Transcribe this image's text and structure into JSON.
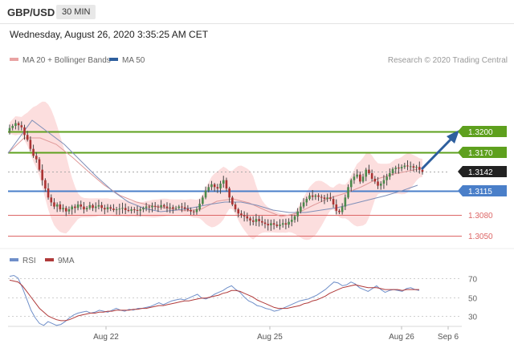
{
  "header": {
    "symbol": "GBP/USD",
    "timeframe": "30 MIN",
    "datetime": "Wednesday, August 26, 2020 3:35:25 AM CET"
  },
  "legend": {
    "ma20": "MA 20 + Bollinger Bands",
    "ma50": "MA 50",
    "copyright": "Research © 2020 Trading Central",
    "rsi": "RSI",
    "ma9": "9MA"
  },
  "colors": {
    "resistance": "#5ea01e",
    "support": "#4a7fc9",
    "weak_level": "#d66",
    "bollinger": "#fcdede",
    "ma20": "#e09a9a",
    "ma50": "#7f8fb8",
    "arrow": "#2e5f9e",
    "candle_up": "#4c8a4c",
    "candle_down": "#a33",
    "rsi": "#6f8fc9",
    "rsi_ma": "#b03a3a"
  },
  "chart_data": [
    {
      "type": "candlestick",
      "title": "",
      "price_range": [
        1.302,
        1.3255
      ],
      "x_ticks": [
        "Aug 22",
        "Aug 25",
        "Aug 26",
        "Sep 6"
      ],
      "levels": [
        {
          "value": 1.32,
          "label": "1.3200",
          "kind": "resistance"
        },
        {
          "value": 1.317,
          "label": "1.3170",
          "kind": "resistance"
        },
        {
          "value": 1.3142,
          "label": "1.3142",
          "kind": "current"
        },
        {
          "value": 1.3115,
          "label": "1.3115",
          "kind": "pivot"
        },
        {
          "value": 1.308,
          "label": "1.3080",
          "kind": "support"
        },
        {
          "value": 1.305,
          "label": "1.3050",
          "kind": "support"
        }
      ],
      "close": [
        1.3205,
        1.3208,
        1.3212,
        1.3209,
        1.3206,
        1.3195,
        1.3188,
        1.3175,
        1.3165,
        1.316,
        1.3145,
        1.313,
        1.3118,
        1.3105,
        1.3098,
        1.3092,
        1.3095,
        1.3088,
        1.309,
        1.3085,
        1.3088,
        1.3092,
        1.309,
        1.3095,
        1.3092,
        1.3088,
        1.309,
        1.3094,
        1.309,
        1.3092,
        1.3094,
        1.309,
        1.3088,
        1.3091,
        1.3089,
        1.3087,
        1.3088,
        1.3089,
        1.309,
        1.3087,
        1.3086,
        1.3088,
        1.3087,
        1.3086,
        1.3088,
        1.309,
        1.3092,
        1.3091,
        1.3093,
        1.3092,
        1.3091,
        1.3094,
        1.3092,
        1.309,
        1.3091,
        1.3089,
        1.309,
        1.3092,
        1.3091,
        1.3089,
        1.3087,
        1.3085,
        1.3084,
        1.3088,
        1.3096,
        1.3105,
        1.3115,
        1.312,
        1.3124,
        1.312,
        1.3118,
        1.3125,
        1.313,
        1.3118,
        1.3105,
        1.3095,
        1.3088,
        1.3082,
        1.308,
        1.3078,
        1.3075,
        1.3072,
        1.307,
        1.3074,
        1.3071,
        1.3069,
        1.3067,
        1.3065,
        1.3068,
        1.3066,
        1.3064,
        1.3066,
        1.3068,
        1.3066,
        1.307,
        1.3073,
        1.3078,
        1.3085,
        1.3092,
        1.3098,
        1.3103,
        1.3108,
        1.3106,
        1.3108,
        1.3106,
        1.3105,
        1.3103,
        1.3105,
        1.3103,
        1.3095,
        1.3086,
        1.3084,
        1.3092,
        1.3105,
        1.312,
        1.313,
        1.3135,
        1.3138,
        1.3128,
        1.3135,
        1.3145,
        1.314,
        1.3132,
        1.3128,
        1.3122,
        1.3125,
        1.313,
        1.3135,
        1.314,
        1.3146,
        1.3148,
        1.3147,
        1.3149,
        1.3151,
        1.315,
        1.315,
        1.3148,
        1.3149,
        1.3145,
        1.3142
      ],
      "ma20_points": [
        [
          10,
          191
        ],
        [
          30,
          172
        ],
        [
          50,
          172
        ],
        [
          70,
          180
        ],
        [
          90,
          196
        ],
        [
          110,
          214
        ],
        [
          130,
          231
        ],
        [
          150,
          244
        ],
        [
          170,
          252
        ],
        [
          190,
          257
        ],
        [
          210,
          260
        ],
        [
          230,
          263
        ],
        [
          250,
          261
        ],
        [
          270,
          251
        ],
        [
          290,
          248
        ],
        [
          310,
          253
        ],
        [
          330,
          262
        ],
        [
          350,
          270
        ],
        [
          370,
          266
        ],
        [
          390,
          256
        ],
        [
          410,
          247
        ],
        [
          430,
          241
        ],
        [
          450,
          233
        ],
        [
          470,
          223
        ],
        [
          490,
          217
        ],
        [
          510,
          213
        ],
        [
          520,
          211
        ]
      ],
      "ma50_points": [
        [
          10,
          191
        ],
        [
          40,
          150
        ],
        [
          60,
          165
        ],
        [
          80,
          180
        ],
        [
          100,
          200
        ],
        [
          120,
          220
        ],
        [
          140,
          238
        ],
        [
          160,
          252
        ],
        [
          180,
          260
        ],
        [
          200,
          264
        ],
        [
          220,
          262
        ],
        [
          240,
          259
        ],
        [
          260,
          255
        ],
        [
          280,
          252
        ],
        [
          300,
          252
        ],
        [
          320,
          256
        ],
        [
          340,
          262
        ],
        [
          360,
          265
        ],
        [
          380,
          265
        ],
        [
          400,
          262
        ],
        [
          420,
          259
        ],
        [
          440,
          254
        ],
        [
          460,
          249
        ],
        [
          480,
          244
        ],
        [
          500,
          238
        ],
        [
          520,
          231
        ]
      ]
    },
    {
      "type": "line",
      "title": "",
      "ylim": [
        20,
        80
      ],
      "y_ticks": [
        30,
        50,
        70
      ],
      "series": [
        {
          "name": "RSI",
          "values": [
            72,
            73,
            70,
            60,
            48,
            36,
            28,
            22,
            20,
            24,
            22,
            20,
            21,
            24,
            28,
            31,
            33,
            34,
            35,
            33,
            34,
            36,
            35,
            34,
            36,
            38,
            36,
            35,
            37,
            36,
            38,
            38,
            39,
            40,
            42,
            44,
            42,
            44,
            46,
            47,
            48,
            47,
            49,
            51,
            53,
            49,
            48,
            50,
            53,
            55,
            57,
            60,
            62,
            58,
            55,
            50,
            46,
            44,
            41,
            40,
            38,
            37,
            35,
            36,
            38,
            40,
            42,
            44,
            46,
            47,
            48,
            50,
            52,
            55,
            58,
            62,
            66,
            65,
            62,
            63,
            66,
            64,
            60,
            58,
            56,
            59,
            62,
            58,
            55,
            57,
            58,
            57,
            56,
            59,
            60,
            58,
            57
          ]
        },
        {
          "name": "9MA",
          "values": [
            68,
            67,
            66,
            62,
            56,
            50,
            44,
            38,
            34,
            30,
            28,
            26,
            25,
            25,
            26,
            28,
            30,
            31,
            32,
            33,
            33,
            34,
            34,
            35,
            35,
            36,
            36,
            36,
            36,
            37,
            37,
            38,
            38,
            39,
            40,
            41,
            41,
            42,
            43,
            44,
            45,
            46,
            46,
            47,
            48,
            49,
            49,
            50,
            51,
            52,
            54,
            55,
            57,
            57,
            56,
            54,
            52,
            50,
            47,
            45,
            43,
            41,
            39,
            38,
            38,
            38,
            39,
            40,
            41,
            43,
            44,
            46,
            47,
            49,
            51,
            54,
            56,
            58,
            60,
            61,
            62,
            63,
            62,
            61,
            60,
            60,
            60,
            59,
            58,
            58,
            58,
            58,
            57,
            58,
            58,
            58,
            58
          ]
        }
      ]
    }
  ]
}
